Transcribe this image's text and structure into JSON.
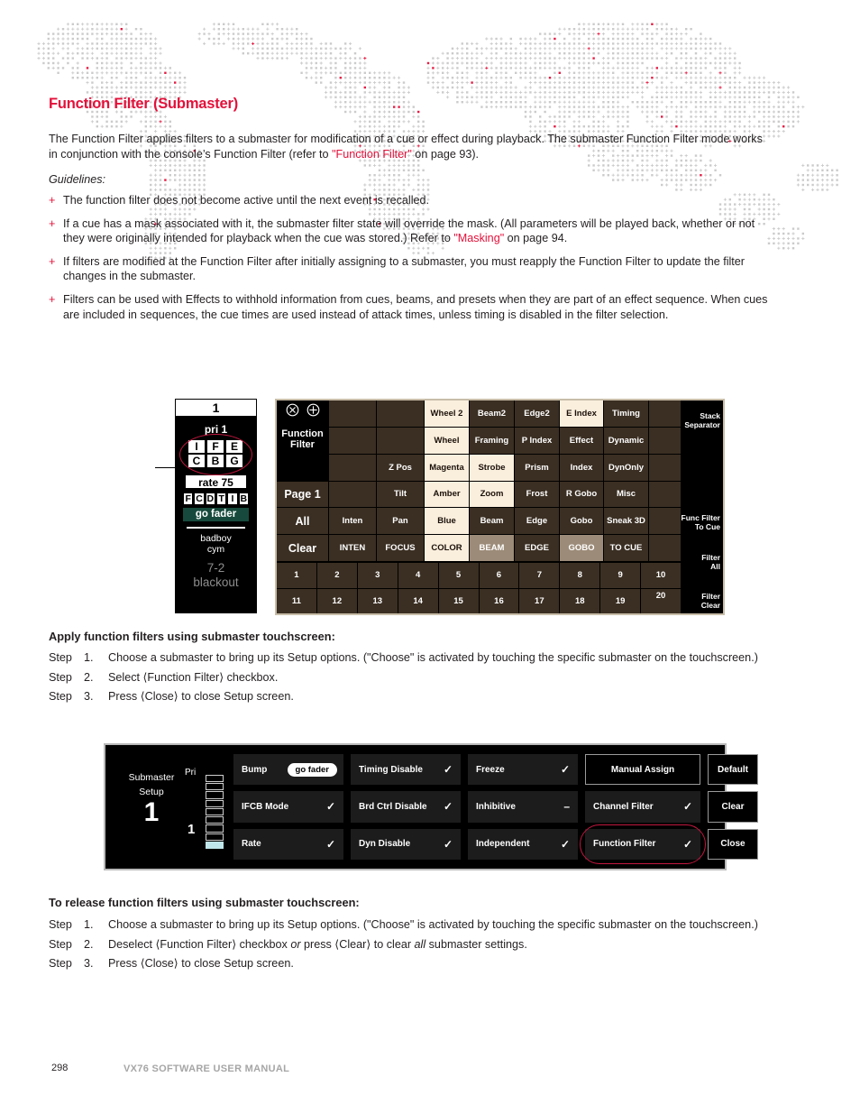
{
  "heading": "Function Filter (Submaster)",
  "heading_color": "#e4103a",
  "intro": {
    "part1": "The Function Filter applies filters to a submaster for modification of a cue or effect during playback. The submaster Function Filter mode works in conjunction with the console’s Function Filter (refer to ",
    "link": "\"Function Filter\"",
    "part2": " on page 93)."
  },
  "guidelines_label": "Guidelines:",
  "bullets": [
    {
      "marker": "+",
      "text": "The function filter does not become active until the next event is recalled."
    },
    {
      "marker": "+",
      "pre": "If a cue has a mask associated with it, the submaster filter state will override the mask. (All parameters will be played back, whether or not they were originally intended for playback when the cue was stored.) Refer to ",
      "link": "\"Masking\"",
      "post": " on page 94."
    },
    {
      "marker": "+",
      "text": "If filters are modified at the Function Filter after initially assigning to a submaster, you must reapply the Function Filter to update the filter changes in the submaster."
    },
    {
      "marker": "+",
      "text": "Filters can be used with Effects to withhold information from cues, beams, and presets when they are part of an effect sequence. When cues are included in sequences, the cue times are used instead of attack times, unless timing is disabled in the filter selection."
    }
  ],
  "figure1": {
    "submaster": {
      "number": "1",
      "pri": "pri 1",
      "ifcb_row1": [
        "I",
        "F",
        "E"
      ],
      "ifcb_row2": [
        "C",
        "B",
        "G"
      ],
      "rate": "rate 75",
      "fcdtib": [
        "F",
        "C",
        "D",
        "T",
        "I",
        "B"
      ],
      "go_fader": "go fader",
      "fixture_line1": "badboy",
      "fixture_line2": "cym",
      "cue": "7-2",
      "state": "blackout"
    },
    "panel": {
      "title_line1": "Function",
      "title_line2": "Filter",
      "close_icon": "circle-x-icon",
      "add_icon": "circle-plus-icon",
      "left_buttons": [
        "Page 1",
        "All",
        "Clear"
      ],
      "rows": [
        [
          "",
          "",
          "Wheel 2",
          "Beam2",
          "Edge2",
          "E Index",
          "Timing"
        ],
        [
          "",
          "",
          "Wheel",
          "Framing",
          "P Index",
          "Effect",
          "Dynamic"
        ],
        [
          "",
          "Z Pos",
          "Magenta",
          "Strobe",
          "Prism",
          "Index",
          "DynOnly"
        ],
        [
          "",
          "Tilt",
          "Amber",
          "Zoom",
          "Frost",
          "R Gobo",
          "Misc"
        ],
        [
          "Inten",
          "Pan",
          "Blue",
          "Beam",
          "Edge",
          "Gobo",
          "Sneak 3D"
        ],
        [
          "INTEN",
          "FOCUS",
          "COLOR",
          "BEAM",
          "EDGE",
          "GOBO",
          "TO CUE"
        ]
      ],
      "row_states": [
        [
          "blank",
          "blank",
          "lit",
          "off",
          "off",
          "lit",
          "off"
        ],
        [
          "blank",
          "blank",
          "lit",
          "off",
          "off",
          "off",
          "off"
        ],
        [
          "blank",
          "off",
          "lit",
          "lit",
          "off",
          "off",
          "off"
        ],
        [
          "blank",
          "off",
          "lit",
          "lit",
          "off",
          "off",
          "off"
        ],
        [
          "off",
          "off",
          "lit",
          "off",
          "off",
          "off",
          "off"
        ],
        [
          "off",
          "off",
          "lit",
          "mid",
          "off",
          "mid",
          "off"
        ]
      ],
      "numbers_row1": [
        "1",
        "2",
        "3",
        "4",
        "5",
        "6",
        "7",
        "8",
        "9",
        "10"
      ],
      "numbers_row2": [
        "11",
        "12",
        "13",
        "14",
        "15",
        "16",
        "17",
        "18",
        "19",
        "20"
      ],
      "side_buttons": [
        "Stack Separator",
        "Func Filter To Cue",
        "Filter All",
        "Filter Clear"
      ]
    }
  },
  "apply": {
    "heading": "Apply function filters using submaster touchscreen:",
    "steps": [
      {
        "word": "Step",
        "num": "1.",
        "text": "Choose a submaster to bring up its Setup options. (\"Choose\" is activated by touching the specific submaster on the touchscreen.)"
      },
      {
        "word": "Step",
        "num": "2.",
        "text": "Select ⟨Function Filter⟩ checkbox."
      },
      {
        "word": "Step",
        "num": "3.",
        "text": "Press ⟨Close⟩ to close Setup screen."
      }
    ]
  },
  "figure2": {
    "title_line1": "Submaster",
    "title_line2": "Setup",
    "number": "1",
    "pri_label": "Pri",
    "fader_value": "1",
    "buttons": [
      {
        "label": "Bump",
        "state": "pill",
        "pill": "go fader"
      },
      {
        "label": "Timing Disable",
        "state": "check",
        "check": "✓"
      },
      {
        "label": "Freeze",
        "state": "check",
        "check": "✓"
      },
      {
        "label": "Manual Assign",
        "state": "outline-center"
      },
      {
        "label": "Default",
        "state": "outline-center"
      },
      {
        "label": "IFCB Mode",
        "state": "check",
        "check": "✓"
      },
      {
        "label": "Brd Ctrl Disable",
        "state": "check",
        "check": "✓"
      },
      {
        "label": "Inhibitive",
        "state": "dash",
        "check": "–"
      },
      {
        "label": "Channel Filter",
        "state": "check",
        "check": "✓"
      },
      {
        "label": "Clear",
        "state": "outline-center"
      },
      {
        "label": "Rate",
        "state": "check",
        "check": "✓"
      },
      {
        "label": "Dyn Disable",
        "state": "check",
        "check": "✓"
      },
      {
        "label": "Independent",
        "state": "check",
        "check": "✓"
      },
      {
        "label": "Function Filter",
        "state": "check-ringed",
        "check": "✓"
      },
      {
        "label": "Close",
        "state": "outline-center"
      }
    ]
  },
  "release": {
    "heading": "To release function filters using submaster touchscreen:",
    "steps": [
      {
        "word": "Step",
        "num": "1.",
        "text": "Choose a submaster to bring up its Setup options. (\"Choose\" is activated by touching the specific submaster on the touchscreen.)"
      },
      {
        "word": "Step",
        "num": "2.",
        "pre": "Deselect ⟨Function Filter⟩ checkbox ",
        "em1": "or",
        "mid": " press ⟨Clear⟩ to clear ",
        "em2": "all",
        "post": " submaster settings."
      },
      {
        "word": "Step",
        "num": "3.",
        "text": "Press ⟨Close⟩ to close Setup screen."
      }
    ]
  },
  "footer": {
    "page_number": "298",
    "manual_title": "VX76 SOFTWARE USER MANUAL"
  }
}
